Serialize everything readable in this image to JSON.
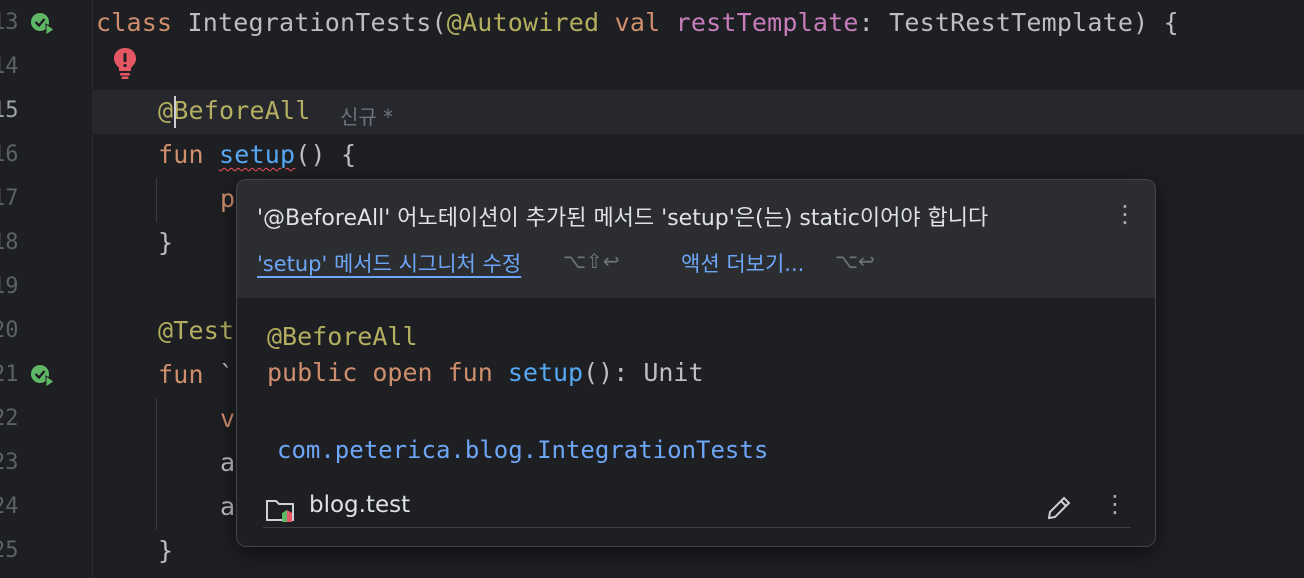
{
  "editor": {
    "line_numbers": [
      "13",
      "14",
      "15",
      "16",
      "17",
      "18",
      "19",
      "20",
      "21",
      "22",
      "23",
      "24",
      "25"
    ],
    "lines": {
      "l13": {
        "kw1": "class ",
        "name": "IntegrationTests(",
        "ann": "@Autowired ",
        "kw2": "val ",
        "prop": "restTemplate",
        "rest": ": TestRestTemplate) {"
      },
      "l15": {
        "ann": "@BeforeAll"
      },
      "l16": {
        "kw": "fun ",
        "fn": "setup",
        "rest": "() {"
      },
      "l17": {
        "text": "p"
      },
      "l18": {
        "text": "}"
      },
      "l20": {
        "ann": "@Test"
      },
      "l21": {
        "kw": "fun ",
        "rest": "`"
      },
      "l22": {
        "text": "v"
      },
      "l23": {
        "text": "a"
      },
      "l24": {
        "text": "a"
      },
      "l25": {
        "text": "}"
      }
    },
    "inlay_hint": "신규 *"
  },
  "popup": {
    "title": "'@BeforeAll' 어노테이션이 추가된 메서드 'setup'은(는) static이어야 합니다",
    "fix_link": "'setup' 메서드 시그니처 수정",
    "fix_shortcut": "⌥⇧↩",
    "more_actions_link": "액션 더보기...",
    "more_actions_shortcut": "⌥↩",
    "code_annotation": "@BeforeAll",
    "sig_public": "public ",
    "sig_open": "open ",
    "sig_fun": "fun ",
    "sig_name": "setup",
    "sig_rest": "(): Unit",
    "package": "com.peterica.blog.IntegrationTests",
    "module": "blog.test"
  },
  "colors": {
    "background": "#1e1f22",
    "keyword": "#cf8e6d",
    "annotation": "#b3ae60",
    "function": "#56a8f5",
    "property": "#c77dbb",
    "link": "#6ea6f7",
    "error": "#f75464"
  }
}
